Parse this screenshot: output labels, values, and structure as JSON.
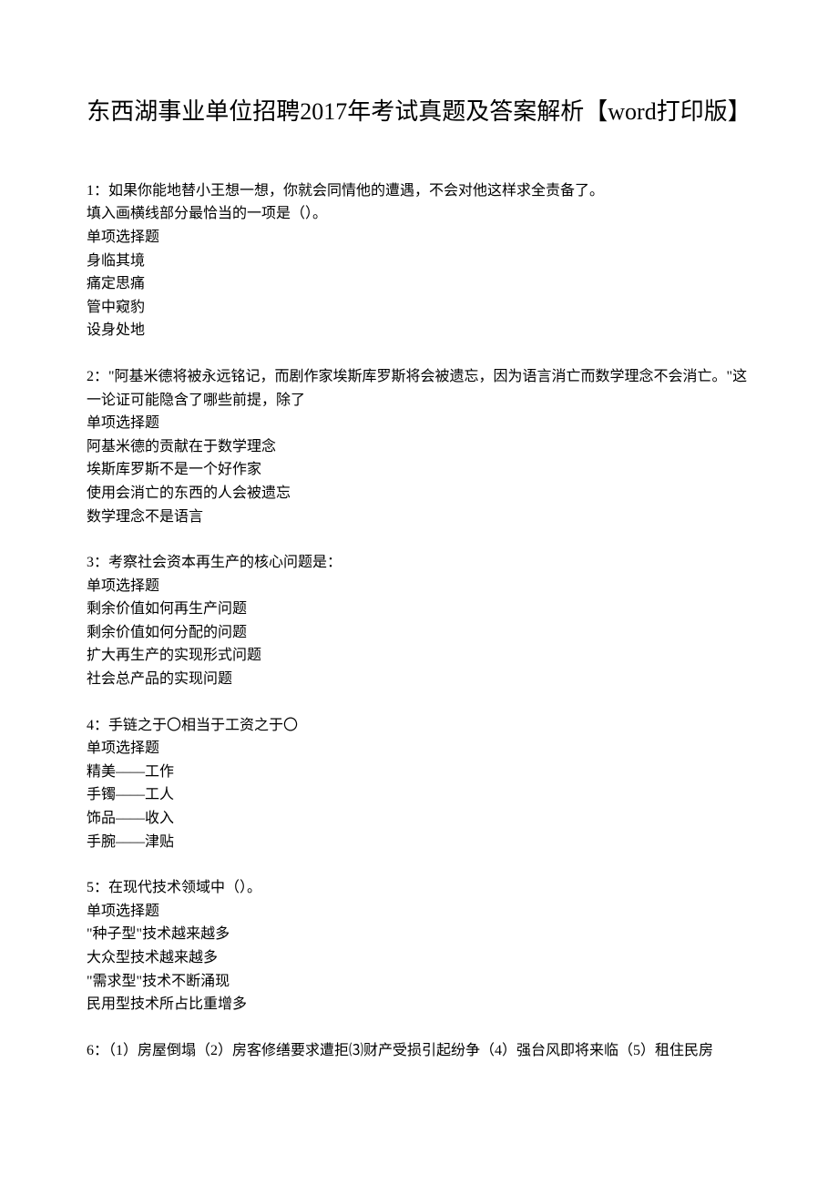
{
  "title": "东西湖事业单位招聘2017年考试真题及答案解析【word打印版】",
  "questions": [
    {
      "number": "1：",
      "stem_lines": [
        "如果你能地替小王想一想，你就会同情他的遭遇，不会对他这样求全责备了。",
        "填入画横线部分最恰当的一项是（）。",
        "单项选择题"
      ],
      "options": [
        "身临其境",
        "痛定思痛",
        "管中窥豹",
        "设身处地"
      ]
    },
    {
      "number": "2：",
      "stem_lines": [
        "\"阿基米德将被永远铭记，而剧作家埃斯库罗斯将会被遗忘，因为语言消亡而数学理念不会消亡。\"这一论证可能隐含了哪些前提，除了",
        "单项选择题"
      ],
      "options": [
        "阿基米德的贡献在于数学理念",
        "埃斯库罗斯不是一个好作家",
        "使用会消亡的东西的人会被遗忘",
        "数学理念不是语言"
      ]
    },
    {
      "number": "3：",
      "stem_lines": [
        "考察社会资本再生产的核心问题是：",
        "单项选择题"
      ],
      "options": [
        "剩余价值如何再生产问题",
        "剩余价值如何分配的问题",
        "扩大再生产的实现形式问题",
        "社会总产品的实现问题"
      ]
    },
    {
      "number": "4：",
      "stem_lines": [
        "手链之于〇相当于工资之于〇",
        "单项选择题"
      ],
      "options": [
        "精美––––工作",
        "手镯––––工人",
        "饰品––––收入",
        "手腕––––津贴"
      ]
    },
    {
      "number": "5：",
      "stem_lines": [
        "在现代技术领域中（）。",
        "单项选择题"
      ],
      "options": [
        "\"种子型\"技术越来越多",
        "大众型技术越来越多",
        "\"需求型\"技术不断涌现",
        "民用型技术所占比重增多"
      ]
    },
    {
      "number": "6：",
      "stem_lines": [
        "（1）房屋倒塌（2）房客修缮要求遭拒⑶财产受损引起纷争（4）强台风即将来临（5）租住民房"
      ],
      "options": []
    }
  ]
}
